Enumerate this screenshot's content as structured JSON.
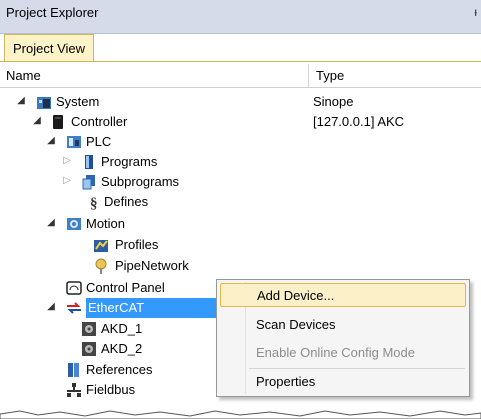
{
  "panel": {
    "title": "Project Explorer",
    "pin_glyph": "ᵻ"
  },
  "tab": {
    "label": "Project View"
  },
  "columns": {
    "name": "Name",
    "type": "Type"
  },
  "tree": [
    {
      "label": "System",
      "type": "Sinope",
      "icon": "system-icon",
      "toggle": "◢"
    },
    {
      "label": "Controller",
      "type": "[127.0.0.1] AKC",
      "icon": "controller-icon",
      "toggle": "◢"
    },
    {
      "label": "PLC",
      "type": "",
      "icon": "plc-icon",
      "toggle": "◢"
    },
    {
      "label": "Programs",
      "type": "",
      "icon": "programs-icon",
      "toggle": "▷"
    },
    {
      "label": "Subprograms",
      "type": "",
      "icon": "subprograms-icon",
      "toggle": "▷"
    },
    {
      "label": "Defines",
      "type": "",
      "icon": "defines-icon",
      "toggle": ""
    },
    {
      "label": "Motion",
      "type": "",
      "icon": "motion-icon",
      "toggle": "◢"
    },
    {
      "label": "Profiles",
      "type": "",
      "icon": "profiles-icon",
      "toggle": ""
    },
    {
      "label": "PipeNetwork",
      "type": "",
      "icon": "pipenetwork-icon",
      "toggle": ""
    },
    {
      "label": "Control Panel",
      "type": "",
      "icon": "control-panel-icon",
      "toggle": ""
    },
    {
      "label": "EtherCAT",
      "type": "",
      "icon": "ethercat-icon",
      "toggle": "◢"
    },
    {
      "label": "AKD_1",
      "type": "",
      "icon": "drive-icon",
      "toggle": ""
    },
    {
      "label": "AKD_2",
      "type": "",
      "icon": "drive-icon",
      "toggle": ""
    },
    {
      "label": "References",
      "type": "",
      "icon": "references-icon",
      "toggle": ""
    },
    {
      "label": "Fieldbus",
      "type": "",
      "icon": "fieldbus-icon",
      "toggle": ""
    }
  ],
  "context_menu": {
    "items": [
      {
        "label": "Add Device...",
        "state": "hover"
      },
      {
        "label": "Scan Devices",
        "state": "normal"
      },
      {
        "label": "Enable Online Config Mode",
        "state": "disabled"
      },
      {
        "label": "Properties",
        "state": "normal"
      }
    ]
  },
  "colors": {
    "selection": "#3399ff",
    "titlebar": "#d6dbe9",
    "tab": "#fdf3c8",
    "menu_hover": "#fbf0c8"
  }
}
